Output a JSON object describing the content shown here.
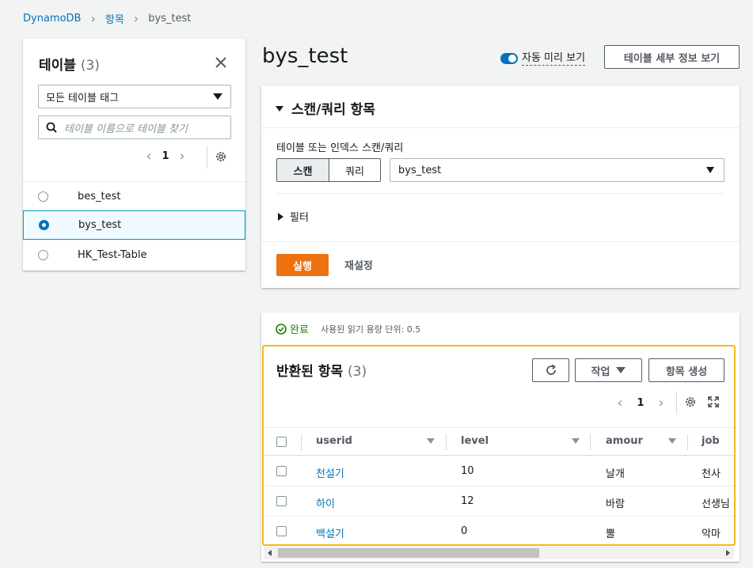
{
  "breadcrumb": [
    "DynamoDB",
    "항목",
    "bys_test"
  ],
  "left_panel": {
    "title": "테이블",
    "count": "(3)",
    "tag_filter": "모든 테이블 태그",
    "search_placeholder": "테이블 이름으로 테이블 찾기",
    "page": "1",
    "tables": [
      {
        "name": "bes_test",
        "selected": false
      },
      {
        "name": "bys_test",
        "selected": true
      },
      {
        "name": "HK_Test-Table",
        "selected": false
      }
    ]
  },
  "page_title": "bys_test",
  "auto_preview_label": "자동 미리 보기",
  "details_button": "테이블 세부 정보 보기",
  "scan": {
    "title": "스캔/쿼리 항목",
    "label": "테이블 또는 인덱스 스캔/쿼리",
    "scan_label": "스캔",
    "query_label": "쿼리",
    "selected_table": "bys_test",
    "filter_label": "필터",
    "run_label": "실행",
    "reset_label": "재설정"
  },
  "results": {
    "status": "완료",
    "read_units": "사용된 읽기 용량 단위: 0.5",
    "title": "반환된 항목",
    "count": "(3)",
    "action_label": "작업",
    "create_label": "항목 생성",
    "page": "1",
    "columns": [
      "userid",
      "level",
      "amour",
      "job"
    ],
    "rows": [
      [
        "천설기",
        "10",
        "날개",
        "천사"
      ],
      [
        "하이",
        "12",
        "바람",
        "선생님"
      ],
      [
        "백설기",
        "0",
        "뿔",
        "악마"
      ]
    ]
  },
  "colors": {
    "accent": "#0073bb",
    "run": "#ec7211",
    "highlight": "#f7b718",
    "success": "#1d8102"
  }
}
